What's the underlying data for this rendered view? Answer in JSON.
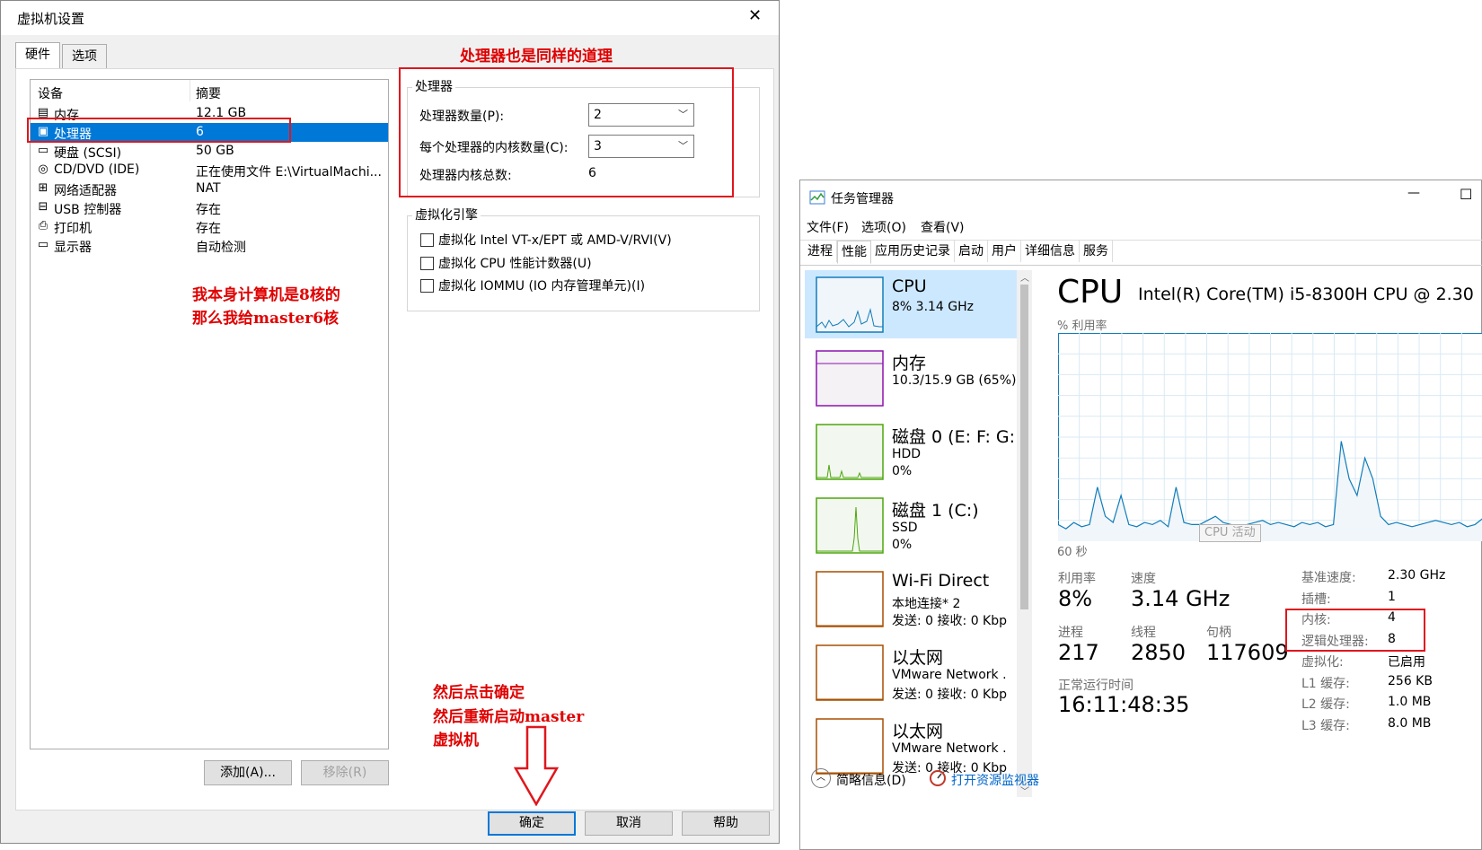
{
  "vm": {
    "title": "虚拟机设置",
    "close": "✕",
    "tabs": [
      "硬件",
      "选项"
    ],
    "table": {
      "headers": [
        "设备",
        "摘要"
      ],
      "rows": [
        {
          "icon": "memory-icon",
          "glyph": "▤",
          "device": "内存",
          "summary": "12.1 GB"
        },
        {
          "icon": "processor-icon",
          "glyph": "▣",
          "device": "处理器",
          "summary": "6"
        },
        {
          "icon": "harddisk-icon",
          "glyph": "▭",
          "device": "硬盘 (SCSI)",
          "summary": "50 GB"
        },
        {
          "icon": "cd-dvd-icon",
          "glyph": "◎",
          "device": "CD/DVD (IDE)",
          "summary": "正在使用文件 E:\\VirtualMachi..."
        },
        {
          "icon": "network-adapter-icon",
          "glyph": "⊞",
          "device": "网络适配器",
          "summary": "NAT"
        },
        {
          "icon": "usb-icon",
          "glyph": "⊟",
          "device": "USB 控制器",
          "summary": "存在"
        },
        {
          "icon": "printer-icon",
          "glyph": "⎙",
          "device": "打印机",
          "summary": "存在"
        },
        {
          "icon": "display-icon",
          "glyph": "▭",
          "device": "显示器",
          "summary": "自动检测"
        }
      ]
    },
    "processor": {
      "group_title": "处理器",
      "count_label": "处理器数量(P):",
      "count_value": "2",
      "cores_label": "每个处理器的内核数量(C):",
      "cores_value": "3",
      "total_label": "处理器内核总数:",
      "total_value": "6"
    },
    "virtualization": {
      "group_title": "虚拟化引擎",
      "options": [
        "虚拟化 Intel VT-x/EPT 或 AMD-V/RVI(V)",
        "虚拟化 CPU 性能计数器(U)",
        "虚拟化 IOMMU (IO 内存管理单元)(I)"
      ]
    },
    "buttons": {
      "add": "添加(A)...",
      "remove": "移除(R)",
      "ok": "确定",
      "cancel": "取消",
      "help": "帮助"
    }
  },
  "annotations": {
    "top": "处理器也是同样的道理",
    "left_line1": "我本身计算机是8核的",
    "left_line2": "那么我给master6核",
    "bottom_line1": "然后点击确定",
    "bottom_line2": "然后重新启动master",
    "bottom_line3": "虚拟机",
    "color": "#e00000"
  },
  "taskmgr": {
    "title": "任务管理器",
    "minimize": "—",
    "maximize": "☐",
    "menu": [
      "文件(F)",
      "选项(O)",
      "查看(V)"
    ],
    "tabs": [
      "进程",
      "性能",
      "应用历史记录",
      "启动",
      "用户",
      "详细信息",
      "服务"
    ],
    "sidebar": [
      {
        "name": "CPU",
        "line1": "8% 3.14 GHz",
        "line2": "",
        "color": "#117dbb",
        "fill": "#f1f6fa"
      },
      {
        "name": "内存",
        "line1": "10.3/15.9 GB (65%)",
        "line2": "",
        "color": "#8b12ae",
        "fill": "#f4f2f4"
      },
      {
        "name": "磁盘 0 (E: F: G:",
        "line1": "HDD",
        "line2": "0%",
        "color": "#4da60c",
        "fill": "#f2f8ef"
      },
      {
        "name": "磁盘 1 (C:)",
        "line1": "SSD",
        "line2": "0%",
        "color": "#4da60c",
        "fill": "#f2f8ef"
      },
      {
        "name": "Wi-Fi Direct",
        "line1": "本地连接* 2",
        "line2": "发送: 0 接收: 0 Kbp",
        "color": "#a74f01",
        "fill": "#ffffff"
      },
      {
        "name": "以太网",
        "line1": "VMware Network .",
        "line2": "发送: 0 接收: 0 Kbp",
        "color": "#a74f01",
        "fill": "#ffffff"
      },
      {
        "name": "以太网",
        "line1": "VMware Network .",
        "line2": "发送: 0 接收: 0 Kbp",
        "color": "#a74f01",
        "fill": "#ffffff"
      }
    ],
    "cpu": {
      "heading": "CPU",
      "model": "Intel(R) Core(TM) i5-8300H CPU @ 2.30",
      "graph_label": "% 利用率",
      "graph_time": "60 秒",
      "graph_tooltip": "CPU 活动",
      "utilization_label": "利用率",
      "utilization": "8%",
      "speed_label": "速度",
      "speed": "3.14 GHz",
      "processes_label": "进程",
      "processes": "217",
      "threads_label": "线程",
      "threads": "2850",
      "handles_label": "句柄",
      "handles": "117609",
      "uptime_label": "正常运行时间",
      "uptime": "16:11:48:35",
      "details": [
        {
          "k": "基准速度:",
          "v": "2.30 GHz"
        },
        {
          "k": "插槽:",
          "v": "1"
        },
        {
          "k": "内核:",
          "v": "4"
        },
        {
          "k": "逻辑处理器:",
          "v": "8"
        },
        {
          "k": "虚拟化:",
          "v": "已启用"
        },
        {
          "k": "L1 缓存:",
          "v": "256 KB"
        },
        {
          "k": "L2 缓存:",
          "v": "1.0 MB"
        },
        {
          "k": "L3 缓存:",
          "v": "8.0 MB"
        }
      ]
    },
    "footer": {
      "less_details": "简略信息(D)",
      "open_monitor": "打开资源监视器"
    }
  }
}
